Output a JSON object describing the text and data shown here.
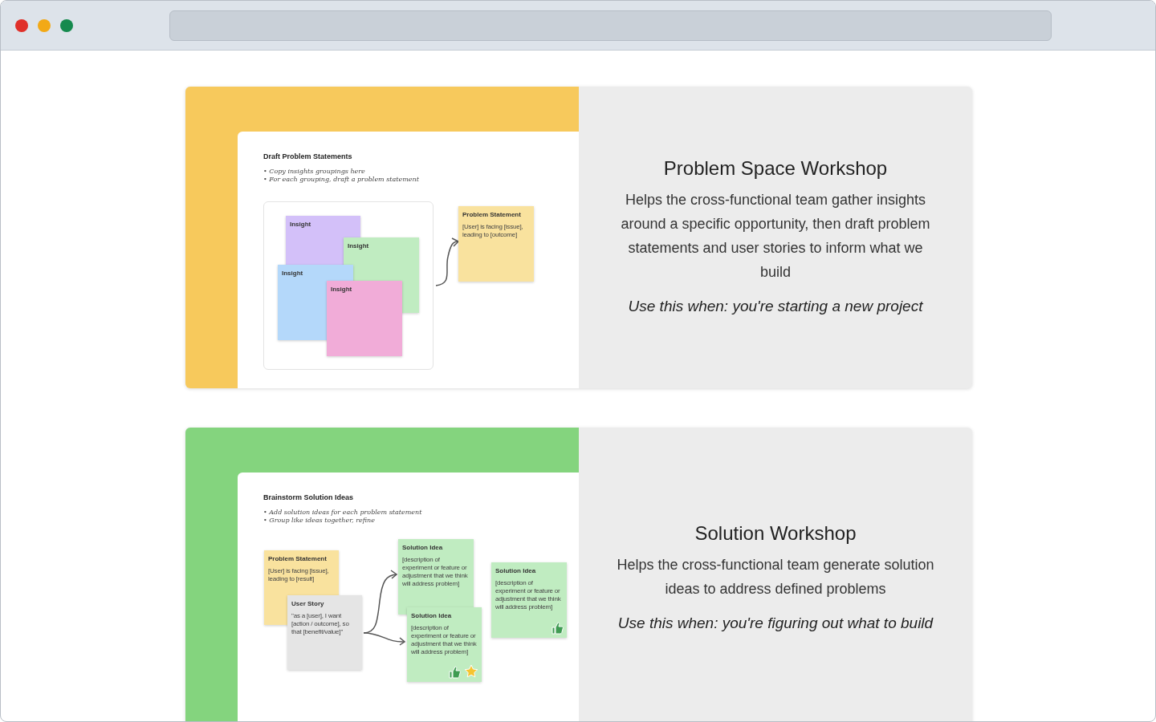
{
  "cards": [
    {
      "color": "#f7c95c",
      "title": "Problem Space Workshop",
      "description": "Helps the cross-functional team gather insights around a specific opportunity, then draft problem statements and user stories to inform what we build",
      "use_when": "Use this when: you're starting a new project",
      "preview": {
        "title": "Draft Problem Statements",
        "bullets": [
          "• Copy insights groupings here",
          "• For each grouping, draft a problem statement"
        ],
        "notes": [
          {
            "title": "Insight",
            "color": "#d3c0f9"
          },
          {
            "title": "Insight",
            "color": "#c0ecc1"
          },
          {
            "title": "Insight",
            "color": "#b4d8fa"
          },
          {
            "title": "Insight",
            "color": "#f1acd8"
          },
          {
            "title": "Problem Statement",
            "body": "[User] is facing [issue], leading to [outcome]",
            "color": "#f9e29e"
          }
        ]
      }
    },
    {
      "color": "#84d47e",
      "title": "Solution Workshop",
      "description": "Helps the cross-functional team generate solution ideas to address defined problems",
      "use_when": "Use this when: you're figuring out what to build",
      "preview": {
        "title": "Brainstorm Solution Ideas",
        "bullets": [
          "• Add solution ideas for each problem statement",
          "• Group like ideas together, refine"
        ],
        "notes": [
          {
            "title": "Problem Statement",
            "body": "[User] is facing [issue], leading to [result]",
            "color": "#f9e29e"
          },
          {
            "title": "User Story",
            "body": "\"as a [user], I want [action / outcome], so that [benefit/value]\"",
            "color": "#e5e5e5"
          },
          {
            "title": "Solution Idea",
            "body": "[description of experiment or feature or adjustment that we think will address problem]",
            "color": "#c0ecc1"
          },
          {
            "title": "Solution Idea",
            "body": "[description of experiment or feature or adjustment that we think will address problem]",
            "color": "#c0ecc1"
          },
          {
            "title": "Solution Idea",
            "body": "[description of experiment or feature or adjustment that we think will address problem]",
            "color": "#c0ecc1"
          }
        ]
      }
    }
  ]
}
